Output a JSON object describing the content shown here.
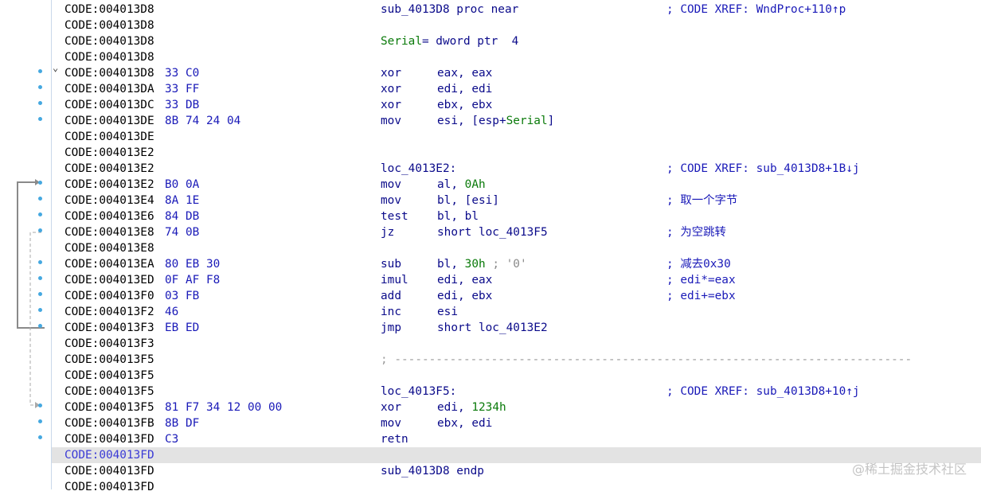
{
  "watermark": "@稀土掘金技术社区",
  "lines": [
    {
      "addr": "CODE:004013D8",
      "bytes": "",
      "label": "sub_4013D8 proc near",
      "comment": "; CODE XREF: WndProc+110↑p"
    },
    {
      "addr": "CODE:004013D8"
    },
    {
      "addr": "CODE:004013D8",
      "var": "Serial",
      "var_def": "= dword ptr  4"
    },
    {
      "addr": "CODE:004013D8"
    },
    {
      "addr": "CODE:004013D8",
      "bytes": "33 C0",
      "mnem": "xor",
      "ops": "eax, eax",
      "dot": true,
      "chev": true
    },
    {
      "addr": "CODE:004013DA",
      "bytes": "33 FF",
      "mnem": "xor",
      "ops": "edi, edi",
      "dot": true
    },
    {
      "addr": "CODE:004013DC",
      "bytes": "33 DB",
      "mnem": "xor",
      "ops": "ebx, ebx",
      "dot": true
    },
    {
      "addr": "CODE:004013DE",
      "bytes": "8B 74 24 04",
      "mnem": "mov",
      "ops": "esi, [esp+",
      "ops_var": "Serial",
      "ops_end": "]",
      "dot": true
    },
    {
      "addr": "CODE:004013DE"
    },
    {
      "addr": "CODE:004013E2"
    },
    {
      "addr": "CODE:004013E2",
      "label": "loc_4013E2:",
      "comment": "; CODE XREF: sub_4013D8+1B↓j"
    },
    {
      "addr": "CODE:004013E2",
      "bytes": "B0 0A",
      "mnem": "mov",
      "ops": "al, ",
      "ops_num": "0Ah",
      "dot": true
    },
    {
      "addr": "CODE:004013E4",
      "bytes": "8A 1E",
      "mnem": "mov",
      "ops": "bl, [esi]",
      "comment": "; 取一个字节",
      "dot": true
    },
    {
      "addr": "CODE:004013E6",
      "bytes": "84 DB",
      "mnem": "test",
      "ops": "bl, bl",
      "dot": true
    },
    {
      "addr": "CODE:004013E8",
      "bytes": "74 0B",
      "mnem": "jz",
      "ops": "short loc_4013F5",
      "comment": "; 为空跳转",
      "dot": true
    },
    {
      "addr": "CODE:004013E8"
    },
    {
      "addr": "CODE:004013EA",
      "bytes": "80 EB 30",
      "mnem": "sub",
      "ops": "bl, ",
      "ops_num": "30h",
      "ops_cmt": " ; '0'",
      "comment": "; 减去0x30",
      "dot": true
    },
    {
      "addr": "CODE:004013ED",
      "bytes": "0F AF F8",
      "mnem": "imul",
      "ops": "edi, eax",
      "comment": "; edi*=eax",
      "dot": true
    },
    {
      "addr": "CODE:004013F0",
      "bytes": "03 FB",
      "mnem": "add",
      "ops": "edi, ebx",
      "comment": "; edi+=ebx",
      "dot": true
    },
    {
      "addr": "CODE:004013F2",
      "bytes": "46",
      "mnem": "inc",
      "ops": "esi",
      "dot": true
    },
    {
      "addr": "CODE:004013F3",
      "bytes": "EB ED",
      "mnem": "jmp",
      "ops": "short loc_4013E2",
      "dot": true
    },
    {
      "addr": "CODE:004013F3"
    },
    {
      "addr": "CODE:004013F5",
      "sep": "; ---------------------------------------------------------------------------"
    },
    {
      "addr": "CODE:004013F5"
    },
    {
      "addr": "CODE:004013F5",
      "label": "loc_4013F5:",
      "comment": "; CODE XREF: sub_4013D8+10↑j"
    },
    {
      "addr": "CODE:004013F5",
      "bytes": "81 F7 34 12 00 00",
      "mnem": "xor",
      "ops": "edi, ",
      "ops_num": "1234h",
      "dot": true
    },
    {
      "addr": "CODE:004013FB",
      "bytes": "8B DF",
      "mnem": "mov",
      "ops": "ebx, edi",
      "dot": true
    },
    {
      "addr": "CODE:004013FD",
      "bytes": "C3",
      "mnem": "retn",
      "ops": "",
      "dot": true
    },
    {
      "addr": "CODE:004013FD",
      "highlight": true
    },
    {
      "addr": "CODE:004013FD",
      "label": "sub_4013D8 endp"
    },
    {
      "addr": "CODE:004013FD"
    }
  ]
}
